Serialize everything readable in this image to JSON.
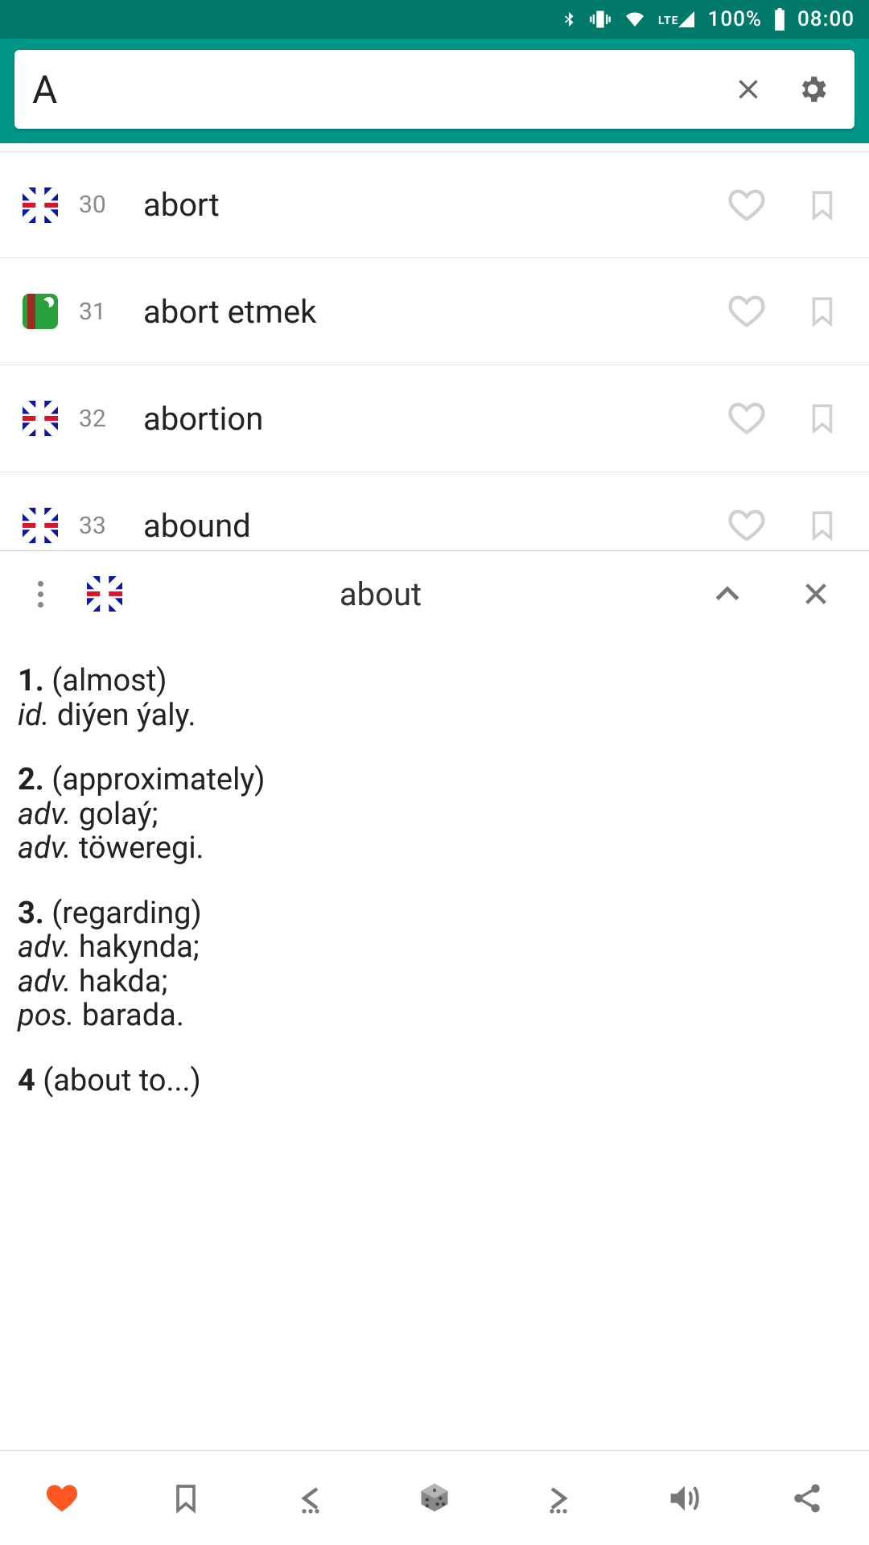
{
  "status_bar": {
    "battery_pct": "100%",
    "clock": "08:00",
    "network_label": "LTE"
  },
  "search": {
    "value": "A"
  },
  "words": [
    {
      "index": "30",
      "lang": "uk",
      "text": "abort"
    },
    {
      "index": "31",
      "lang": "tm",
      "text": "abort etmek"
    },
    {
      "index": "32",
      "lang": "uk",
      "text": "abortion"
    },
    {
      "index": "33",
      "lang": "uk",
      "text": "abound"
    }
  ],
  "detail": {
    "headword": "about",
    "lang": "uk",
    "senses": [
      {
        "n": "1.",
        "gloss": "(almost)",
        "translations": [
          {
            "pos": "id.",
            "text": " diýen ýaly."
          }
        ]
      },
      {
        "n": "2.",
        "gloss": "(approximately)",
        "translations": [
          {
            "pos": "adv.",
            "text": " golaý;"
          },
          {
            "pos": "adv.",
            "text": " töweregi."
          }
        ]
      },
      {
        "n": "3.",
        "gloss": "(regarding)",
        "translations": [
          {
            "pos": "adv.",
            "text": " hakynda;"
          },
          {
            "pos": "adv.",
            "text": " hakda;"
          },
          {
            "pos": "pos.",
            "text": " barada."
          }
        ]
      },
      {
        "n": "4",
        "gloss": "(about to...)",
        "translations": []
      }
    ]
  }
}
